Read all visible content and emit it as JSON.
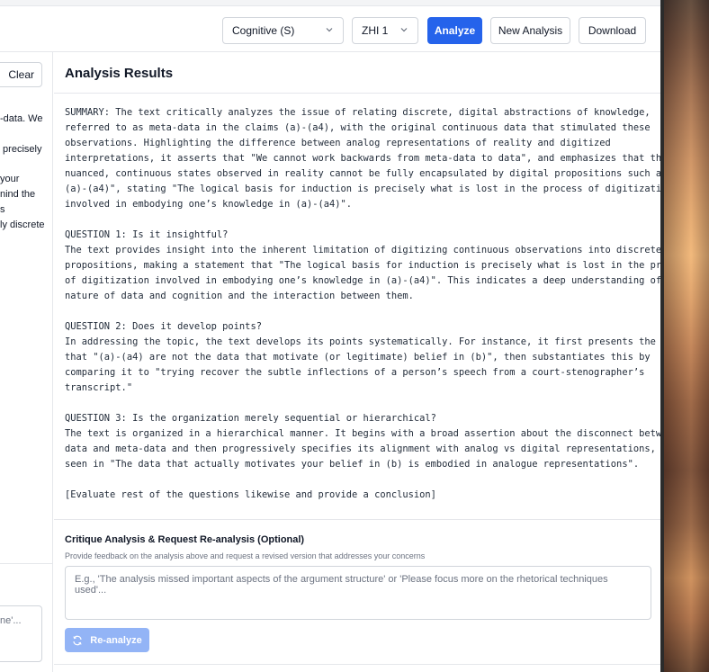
{
  "toolbar": {
    "mode_select": "Cognitive (S)",
    "level_select": "ZHI 1",
    "analyze_label": "Analyze",
    "new_analysis_label": "New Analysis",
    "download_label": "Download"
  },
  "left_panel": {
    "clear_label": "Clear",
    "partial_text": "-data. We\n\n precisely\n\nyour\nnind the\ns\nly discrete",
    "partial_box_text": "ne'..."
  },
  "results": {
    "title": "Analysis Results",
    "body": "SUMMARY: The text critically analyzes the issue of relating discrete, digital abstractions of knowledge,\nreferred to as meta-data in the claims (a)-(a4), with the original continuous data that stimulated these\nobservations. Highlighting the difference between analog representations of reality and digitized\ninterpretations, it asserts that \"We cannot work backwards from meta-data to data\", and emphasizes that the\nnuanced, continuous states observed in reality cannot be fully encapsulated by digital propositions such as \"\n(a)-(a4)\", stating \"The logical basis for induction is precisely what is lost in the process of digitization\ninvolved in embodying one’s knowledge in (a)-(a4)\".\n\nQUESTION 1: Is it insightful?\nThe text provides insight into the inherent limitation of digitizing continuous observations into discrete\npropositions, making a statement that \"The logical basis for induction is precisely what is lost in the process\nof digitization involved in embodying one’s knowledge in (a)-(a4)\". This indicates a deep understanding of the\nnature of data and cognition and the interaction between them.\n\nQUESTION 2: Does it develop points?\nIn addressing the topic, the text develops its points systematically. For instance, it first presents the idea\nthat \"(a)-(a4) are not the data that motivate (or legitimate) belief in (b)\", then substantiates this by\ncomparing it to \"trying recover the subtle inflections of a person’s speech from a court-stenographer’s\ntranscript.\"\n\nQUESTION 3: Is the organization merely sequential or hierarchical?\nThe text is organized in a hierarchical manner. It begins with a broad assertion about the disconnect between\ndata and meta-data and then progressively specifies its alignment with analog vs digital representations, as\nseen in \"The data that actually motivates your belief in (b) is embodied in analogue representations\".\n\n[Evaluate rest of the questions likewise and provide a conclusion]"
  },
  "critique": {
    "title": "Critique Analysis & Request Re-analysis (Optional)",
    "subtitle": "Provide feedback on the analysis above and request a revised version that addresses your concerns",
    "placeholder": "E.g., 'The analysis missed important aspects of the argument structure' or 'Please focus more on the rhetorical techniques used'...",
    "reanalyze_label": "Re-analyze"
  },
  "colors": {
    "primary": "#2563eb",
    "primary_disabled": "#93b4f6",
    "border": "#d1d5db"
  },
  "icons": {
    "select_chevron": "chevron-down-icon",
    "reanalyze": "refresh-icon"
  }
}
